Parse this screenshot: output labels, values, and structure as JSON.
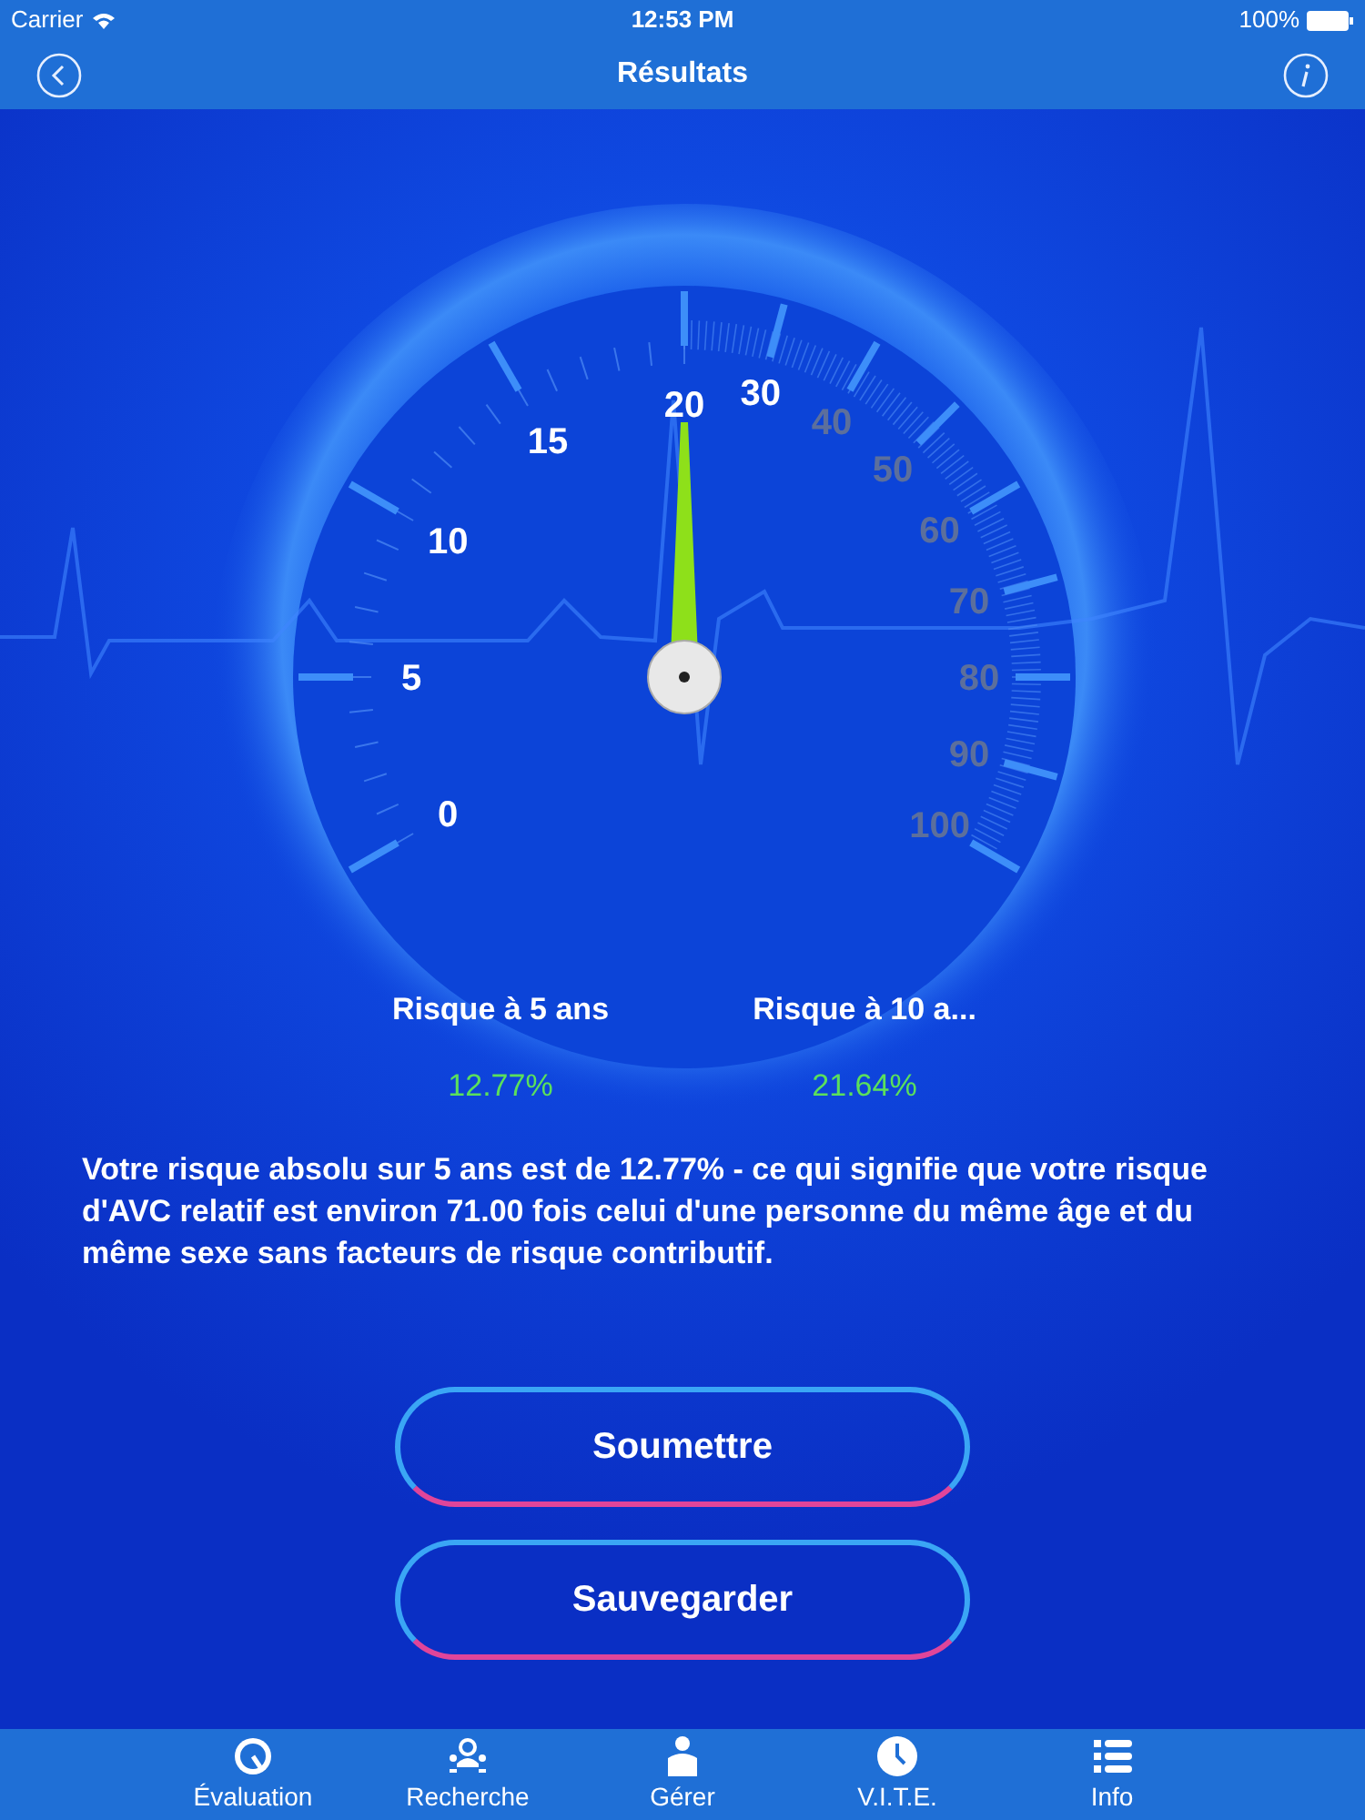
{
  "status_bar": {
    "carrier": "Carrier",
    "time": "12:53 PM",
    "battery": "100%"
  },
  "nav": {
    "title": "Résultats"
  },
  "gauge": {
    "labels": [
      {
        "text": "0",
        "dimmed": false
      },
      {
        "text": "5",
        "dimmed": false
      },
      {
        "text": "10",
        "dimmed": false
      },
      {
        "text": "15",
        "dimmed": false
      },
      {
        "text": "20",
        "dimmed": false
      },
      {
        "text": "30",
        "dimmed": false
      },
      {
        "text": "40",
        "dimmed": true
      },
      {
        "text": "50",
        "dimmed": true
      },
      {
        "text": "60",
        "dimmed": true
      },
      {
        "text": "70",
        "dimmed": true
      },
      {
        "text": "80",
        "dimmed": true
      },
      {
        "text": "90",
        "dimmed": true
      },
      {
        "text": "100",
        "dimmed": true
      }
    ]
  },
  "risks": [
    {
      "label": "Risque à 5 ans",
      "value": "12.77%"
    },
    {
      "label": "Risque à 10 a...",
      "value": "21.64%"
    }
  ],
  "summary": "Votre risque absolu sur 5 ans est de 12.77% - ce qui signifie que votre risque d'AVC relatif est environ 71.00 fois celui d'une personne du même âge et du même sexe sans facteurs de risque contributif.",
  "buttons": [
    "Soumettre",
    "Sauvegarder"
  ],
  "tabs": [
    {
      "label": "Évaluation",
      "selected": false
    },
    {
      "label": "Recherche",
      "selected": false
    },
    {
      "label": "Gérer",
      "selected": false
    },
    {
      "label": "V.I.T.E.",
      "selected": false
    },
    {
      "label": "Info",
      "selected": false
    }
  ]
}
